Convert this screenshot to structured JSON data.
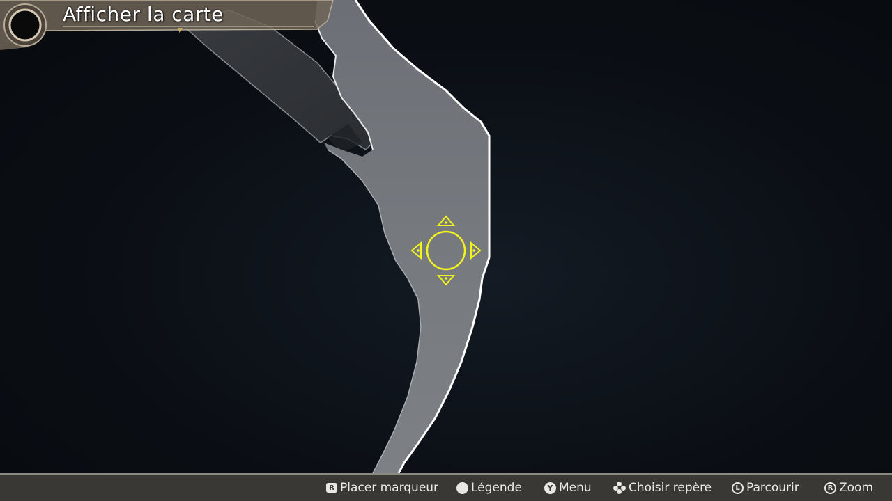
{
  "header": {
    "title": "Afficher la carte"
  },
  "controls": [
    {
      "button": "R",
      "label": "Placer marqueur",
      "icon": "r-button-icon"
    },
    {
      "button": "−",
      "label": "Légende",
      "icon": "minus-button-icon"
    },
    {
      "button": "Y",
      "label": "Menu",
      "icon": "y-button-icon"
    },
    {
      "button": "",
      "label": "Choisir repère",
      "icon": "dpad-icon"
    },
    {
      "button": "L",
      "label": "Parcourir",
      "icon": "left-stick-icon"
    },
    {
      "button": "R",
      "label": "Zoom",
      "icon": "right-stick-icon"
    }
  ],
  "colors": {
    "cursor": "#f2f21e",
    "path_fill": "#6f7378",
    "path_edge": "#ffffff",
    "bar_bg": "#3a3835",
    "title_plate": "#8a7d6a"
  }
}
